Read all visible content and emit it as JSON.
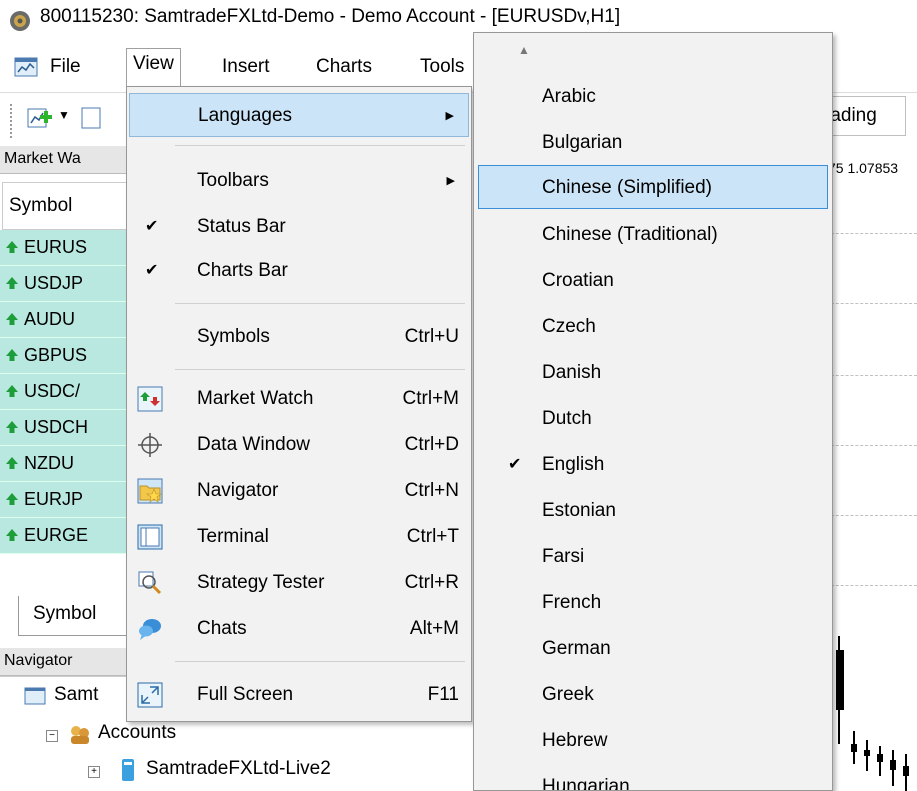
{
  "window": {
    "title": "800115230: SamtradeFXLtd-Demo - Demo Account - [EURUSDv,H1]"
  },
  "menubar": [
    "File",
    "View",
    "Insert",
    "Charts",
    "Tools"
  ],
  "toolbar": {
    "algo_label": "rading"
  },
  "market_watch": {
    "header": "Market Wa",
    "column": "Symbol",
    "rows": [
      "EURUS",
      "USDJP",
      "AUDU",
      "GBPUS",
      "USDC/",
      "USDCH",
      "NZDU",
      "EURJP",
      "EURGE"
    ],
    "tab": "Symbol"
  },
  "navigator": {
    "header": "Navigator",
    "root": "Samt",
    "accounts": "Accounts",
    "server": "SamtradeFXLtd-Live2"
  },
  "chart": {
    "price_label": "75 1.07853"
  },
  "view_menu": {
    "items": [
      {
        "label": "Languages",
        "submenu": true,
        "highlighted": true
      },
      {
        "label": "Toolbars",
        "submenu": true
      },
      {
        "label": "Status Bar",
        "checked": true
      },
      {
        "label": "Charts Bar",
        "checked": true
      },
      {
        "label": "Symbols",
        "shortcut": "Ctrl+U"
      },
      {
        "label": "Market Watch",
        "shortcut": "Ctrl+M",
        "icon": "market-watch-icon"
      },
      {
        "label": "Data Window",
        "shortcut": "Ctrl+D",
        "icon": "crosshair-icon"
      },
      {
        "label": "Navigator",
        "shortcut": "Ctrl+N",
        "icon": "navigator-folder-icon"
      },
      {
        "label": "Terminal",
        "shortcut": "Ctrl+T",
        "icon": "terminal-icon"
      },
      {
        "label": "Strategy Tester",
        "shortcut": "Ctrl+R",
        "icon": "strategy-tester-icon"
      },
      {
        "label": "Chats",
        "shortcut": "Alt+M",
        "icon": "chat-bubbles-icon"
      },
      {
        "label": "Full Screen",
        "shortcut": "F11",
        "icon": "fullscreen-icon"
      }
    ]
  },
  "languages_menu": {
    "items": [
      {
        "label": "Arabic"
      },
      {
        "label": "Bulgarian"
      },
      {
        "label": "Chinese (Simplified)",
        "highlighted": true
      },
      {
        "label": "Chinese (Traditional)"
      },
      {
        "label": "Croatian"
      },
      {
        "label": "Czech"
      },
      {
        "label": "Danish"
      },
      {
        "label": "Dutch"
      },
      {
        "label": "English",
        "checked": true
      },
      {
        "label": "Estonian"
      },
      {
        "label": "Farsi"
      },
      {
        "label": "French"
      },
      {
        "label": "German"
      },
      {
        "label": "Greek"
      },
      {
        "label": "Hebrew"
      },
      {
        "label": "Hungarian"
      }
    ]
  },
  "colors": {
    "highlight": "#cce4f7",
    "highlight_border": "#3a8ed8",
    "market_watch_row": "#b9e8e0",
    "up_arrow": "#1e9e3a",
    "menu_background": "#f2f2f2"
  }
}
